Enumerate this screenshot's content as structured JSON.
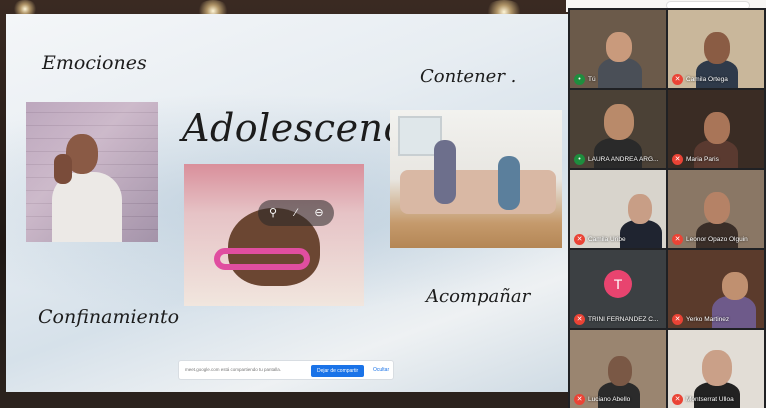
{
  "slide": {
    "words": {
      "emociones": "Emociones",
      "contener": "Contener .",
      "title": "Adolescencia",
      "confinamiento": "Confinamiento",
      "acompanar": "Acompañar"
    },
    "share_bar": {
      "message": "meet.google.com está compartiendo tu pantalla.",
      "stop_label": "Dejar de compartir",
      "hide_label": "Ocultar"
    }
  },
  "gallery": {
    "participants": [
      {
        "name": "Tú",
        "mic": "on"
      },
      {
        "name": "Camila Ortega",
        "mic": "off"
      },
      {
        "name": "LAURA ANDREA ARG...",
        "mic": "on"
      },
      {
        "name": "Maria Paris",
        "mic": "off"
      },
      {
        "name": "Camila Uribe",
        "mic": "off"
      },
      {
        "name": "Leonor Opazo Olguin",
        "mic": "off"
      },
      {
        "name": "TRINI FERNANDEZ C...",
        "mic": "off",
        "initial": "T"
      },
      {
        "name": "Yerko Martinez",
        "mic": "off"
      },
      {
        "name": "Luciano Abello",
        "mic": "off"
      },
      {
        "name": "Montserrat Ulloa",
        "mic": "off"
      }
    ]
  },
  "colors": {
    "meet_blue": "#1a73e8",
    "mic_muted_red": "#ea4335",
    "avatar_pink": "#e8446f"
  }
}
